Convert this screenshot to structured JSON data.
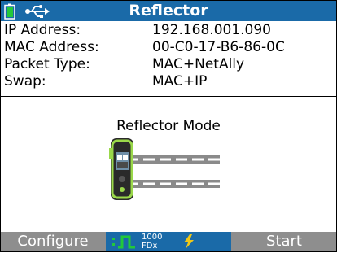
{
  "title": "Reflector",
  "fields": [
    {
      "label": "IP Address:",
      "value": "192.168.001.090"
    },
    {
      "label": "MAC Address:",
      "value": "00-C0-17-B6-86-0C"
    },
    {
      "label": "Packet Type:",
      "value": "MAC+NetAlly"
    },
    {
      "label": "Swap:",
      "value": "MAC+IP"
    }
  ],
  "mode_label": "Reflector Mode",
  "softkeys": {
    "left": "Configure",
    "right": "Start"
  },
  "status": {
    "speed": "1000",
    "duplex": "FDx"
  },
  "icons": [
    "battery-icon",
    "usb-icon",
    "link-pulse-icon",
    "lightning-icon",
    "tester-device-icon"
  ],
  "colors": {
    "accent": "#1a6aa8",
    "softkey_bg": "#8e8e8e",
    "link": "#22c93a",
    "lightning": "#f0c818"
  }
}
